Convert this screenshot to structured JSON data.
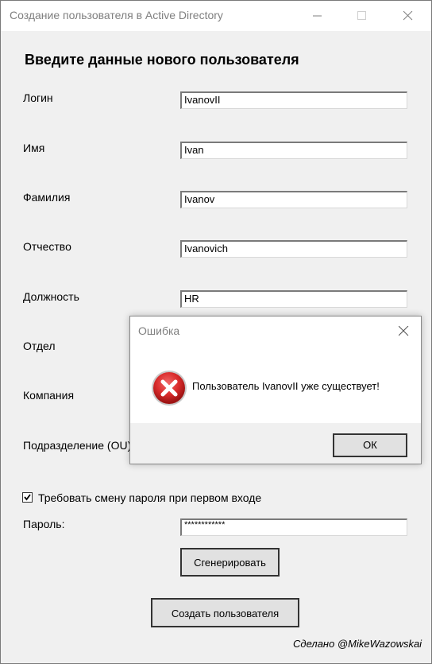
{
  "window": {
    "title": "Создание пользователя в Active Directory"
  },
  "form": {
    "heading": "Введите данные нового пользователя",
    "fields": [
      {
        "label": "Логин",
        "value": "IvanovII"
      },
      {
        "label": "Имя",
        "value": "Ivan"
      },
      {
        "label": "Фамилия",
        "value": "Ivanov"
      },
      {
        "label": "Отчество",
        "value": "Ivanovich"
      },
      {
        "label": "Должность",
        "value": "HR"
      },
      {
        "label": "Отдел",
        "value": ""
      },
      {
        "label": "Компания",
        "value": ""
      },
      {
        "label": "Подразделение (OU)",
        "value": ""
      }
    ],
    "require_password_change": {
      "label": "Требовать смену пароля при первом входе",
      "checked": true
    },
    "password": {
      "label": "Пароль:",
      "value": "************"
    },
    "generate_button": "Сгенерировать",
    "create_button": "Создать пользователя",
    "credit": "Сделано @MikeWazowskai"
  },
  "error_dialog": {
    "title": "Ошибка",
    "message": "Пользователь IvanovII уже существует!",
    "ok_button": "ОК",
    "icon": "error-icon",
    "icon_color": "#d92b2b"
  }
}
